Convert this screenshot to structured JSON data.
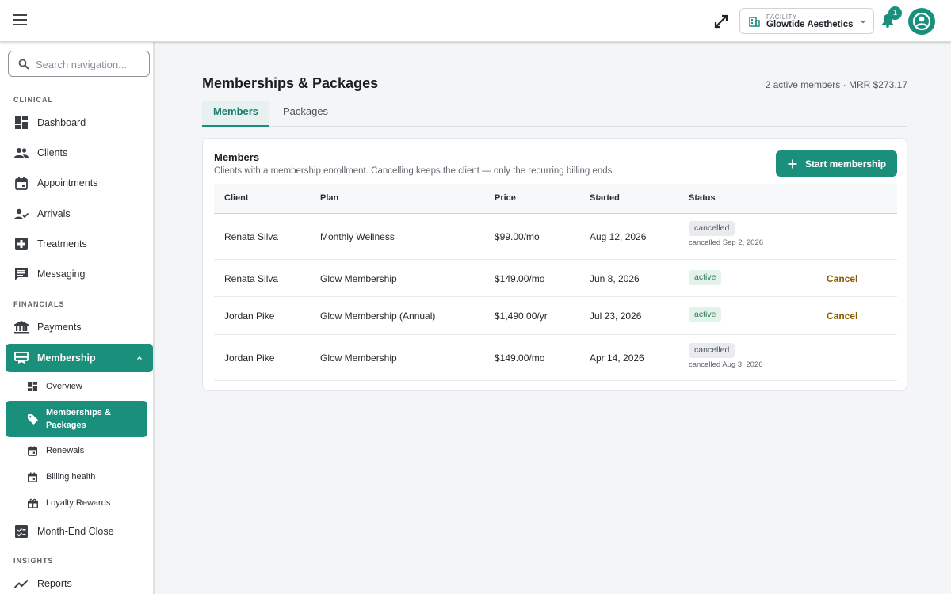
{
  "topbar": {
    "facility_label": "FACILITY",
    "facility_name": "Glowtide Aesthetics",
    "notifications_count": "1"
  },
  "sidebar": {
    "search_placeholder": "Search navigation...",
    "sections": {
      "clinical": "CLINICAL",
      "financials": "FINANCIALS",
      "insights": "INSIGHTS"
    },
    "items": {
      "dashboard": "Dashboard",
      "clients": "Clients",
      "appointments": "Appointments",
      "arrivals": "Arrivals",
      "treatments": "Treatments",
      "messaging": "Messaging",
      "payments": "Payments",
      "membership": "Membership",
      "month_end": "Month-End Close",
      "reports": "Reports"
    },
    "membership_sub": {
      "overview": "Overview",
      "memberships_packages": "Memberships & Packages",
      "renewals": "Renewals",
      "billing_health": "Billing health",
      "loyalty": "Loyalty Rewards"
    },
    "accent_color": "#1a8f7c"
  },
  "main": {
    "title": "Memberships & Packages",
    "stats": "2 active members · MRR $273.17",
    "tabs": [
      "Members",
      "Packages"
    ],
    "card": {
      "title": "Members",
      "subtitle": "Clients with a membership enrollment. Cancelling keeps the client — only the recurring billing ends.",
      "start_button": "Start membership",
      "columns": [
        "Client",
        "Plan",
        "Price",
        "Started",
        "Status"
      ],
      "rows": [
        {
          "client": "Renata Silva",
          "plan": "Monthly Wellness",
          "price": "$99.00/mo",
          "started": "Aug 12, 2026",
          "status": "cancelled",
          "note": "cancelled Sep 2, 2026",
          "action": ""
        },
        {
          "client": "Renata Silva",
          "plan": "Glow Membership",
          "price": "$149.00/mo",
          "started": "Jun 8, 2026",
          "status": "active",
          "note": "",
          "action": "Cancel"
        },
        {
          "client": "Jordan Pike",
          "plan": "Glow Membership (Annual)",
          "price": "$1,490.00/yr",
          "started": "Jul 23, 2026",
          "status": "active",
          "note": "",
          "action": "Cancel"
        },
        {
          "client": "Jordan Pike",
          "plan": "Glow Membership",
          "price": "$149.00/mo",
          "started": "Apr 14, 2026",
          "status": "cancelled",
          "note": "cancelled Aug 3, 2026",
          "action": ""
        }
      ]
    }
  }
}
